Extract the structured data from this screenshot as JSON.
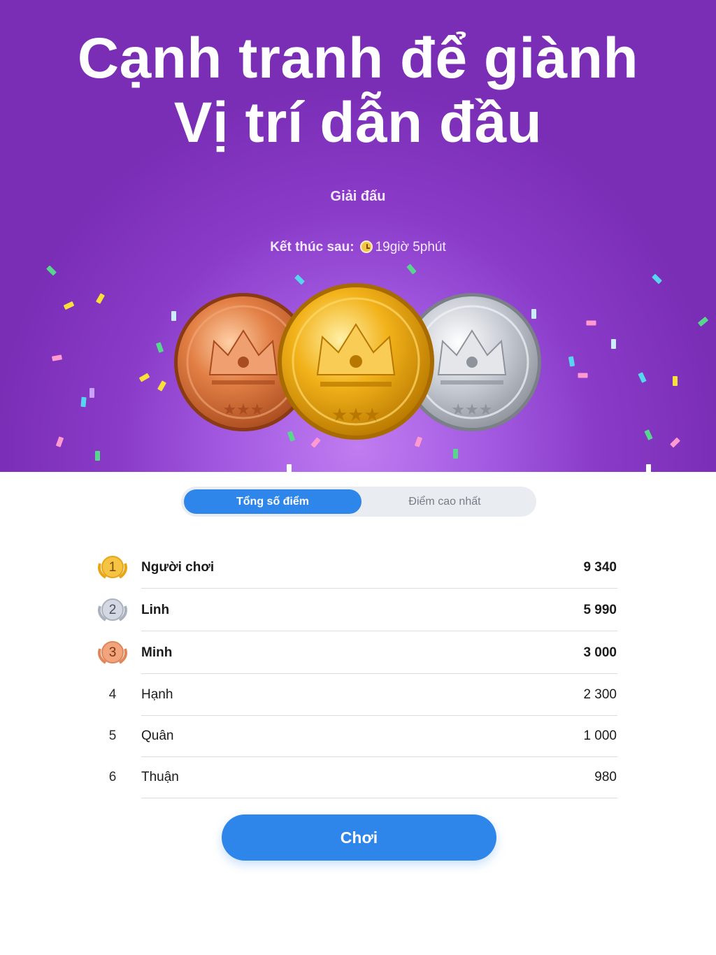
{
  "hero": {
    "headline_line1": "Cạnh tranh để giành",
    "headline_line2": "Vị trí dẫn đầu",
    "league_label": "Giải đấu",
    "ends_label": "Kết thúc sau:",
    "ends_time": "19giờ 5phút",
    "medals": [
      "bronze-medal",
      "gold-medal",
      "silver-medal"
    ]
  },
  "tabs": {
    "total_score": "Tổng số điểm",
    "high_score": "Điểm cao nhất",
    "active": "total_score"
  },
  "leaderboard": [
    {
      "rank": "1",
      "name": "Người chơi",
      "score": "9 340",
      "badge": "gold"
    },
    {
      "rank": "2",
      "name": "Linh",
      "score": "5 990",
      "badge": "silver"
    },
    {
      "rank": "3",
      "name": "Minh",
      "score": "3 000",
      "badge": "bronze"
    },
    {
      "rank": "4",
      "name": "Hạnh",
      "score": "2 300"
    },
    {
      "rank": "5",
      "name": "Quân",
      "score": "1 000"
    },
    {
      "rank": "6",
      "name": "Thuận",
      "score": "980"
    }
  ],
  "play_button": "Chơi",
  "colors": {
    "hero_purple": "#7a2db5",
    "accent_blue": "#2f86ea",
    "gold": "#f2b21a",
    "silver": "#c3c9d6",
    "bronze": "#e8895a"
  }
}
